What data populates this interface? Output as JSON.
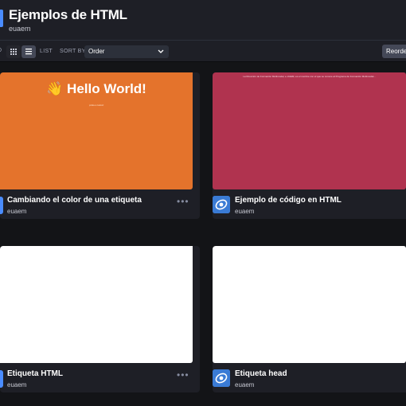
{
  "header": {
    "title": "Ejemplos de HTML",
    "owner": "euaem"
  },
  "toolbar": {
    "cutoff_label": "D",
    "list_label": "LIST",
    "sort_label": "SORT BY",
    "sort_value": "Order",
    "reorder_label": "Reorder"
  },
  "cards": [
    {
      "title": "Cambiando el color de una etiqueta",
      "owner": "euaem",
      "preview_heading": "👋 Hello World!",
      "preview_small": "¡Hola a todos!",
      "preview_color": "#e4732c"
    },
    {
      "title": "Ejemplo de código en HTML",
      "owner": "euaem",
      "preview_text": "La Dirección de Formación Multimodal, e-UAEM, es el nombre con el que se conoce al Programa de Formación Multimodal...",
      "preview_color": "#b0334f"
    },
    {
      "title": "Etiqueta HTML",
      "owner": "euaem",
      "preview_color": "#ffffff"
    },
    {
      "title": "Etiqueta head",
      "owner": "euaem",
      "preview_color": "#ffffff"
    }
  ],
  "icons": [
    "grid-view-icon",
    "list-view-icon",
    "chevron-down-icon",
    "more-options-icon",
    "user-avatar-icon"
  ],
  "colors": {
    "accent": "#4a8cff",
    "background": "#131417",
    "panel": "#1e1f26"
  }
}
